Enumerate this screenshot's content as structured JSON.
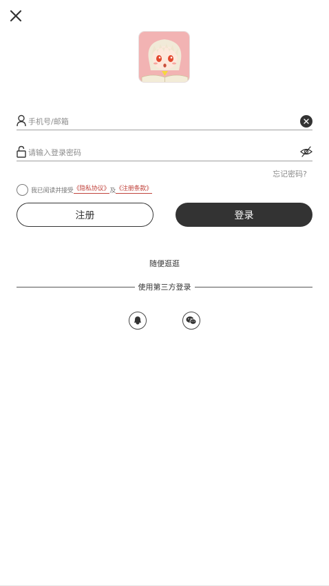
{
  "header": {
    "close_icon": "close-icon"
  },
  "avatar": {
    "icon": "anime-avatar-logo"
  },
  "form": {
    "account_placeholder": "手机号/邮箱",
    "account_value": "",
    "password_placeholder": "请输入登录密码",
    "password_value": "",
    "forgot_password": "忘记密码?"
  },
  "agreement": {
    "checked": false,
    "prefix": "我已阅读并接受",
    "privacy_link": "《隐私协议》",
    "conjunction": "及",
    "terms_link": "《注册条款》"
  },
  "buttons": {
    "register": "注册",
    "login": "登录"
  },
  "browse": {
    "label": "随便逛逛"
  },
  "third_party": {
    "label": "使用第三方登录",
    "providers": [
      "qq-icon",
      "wechat-icon"
    ]
  },
  "colors": {
    "primary_dark": "#333333",
    "link_red": "#c0413a",
    "avatar_bg": "#f2b3b3"
  }
}
